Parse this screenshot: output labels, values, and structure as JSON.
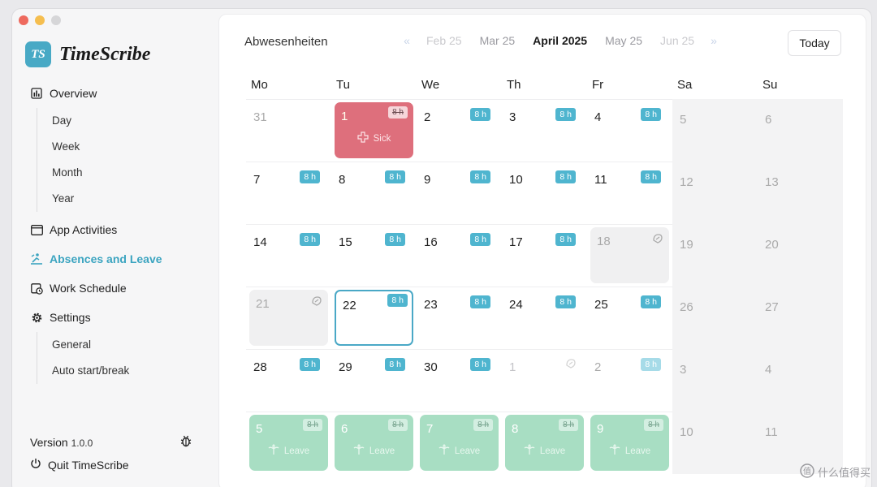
{
  "app": {
    "name": "TimeScribe",
    "logo_text": "TS"
  },
  "sidebar": {
    "overview": "Overview",
    "overview_sub": [
      "Day",
      "Week",
      "Month",
      "Year"
    ],
    "app_activities": "App Activities",
    "absences": "Absences and Leave",
    "work_schedule": "Work Schedule",
    "settings": "Settings",
    "settings_sub": [
      "General",
      "Auto start/break"
    ],
    "version_label": "Version",
    "version_number": "1.0.0",
    "quit": "Quit TimeScribe"
  },
  "main": {
    "title": "Abwesenheiten",
    "months": {
      "far_prev": "Feb 25",
      "prev": "Mar 25",
      "current": "April 2025",
      "next": "May 25",
      "far_next": "Jun 25"
    },
    "today_button": "Today",
    "weekdays": [
      "Mo",
      "Tu",
      "We",
      "Th",
      "Fr",
      "Sa",
      "Su"
    ]
  },
  "calendar": {
    "hours_badge": "8 h",
    "sick_label": "Sick",
    "leave_label": "Leave",
    "weeks": [
      [
        {
          "day": "31",
          "kind": "outside"
        },
        {
          "day": "1",
          "kind": "sick"
        },
        {
          "day": "2",
          "kind": "work"
        },
        {
          "day": "3",
          "kind": "work"
        },
        {
          "day": "4",
          "kind": "work"
        },
        {
          "day": "5",
          "kind": "weekend"
        },
        {
          "day": "6",
          "kind": "weekend"
        }
      ],
      [
        {
          "day": "7",
          "kind": "work"
        },
        {
          "day": "8",
          "kind": "work"
        },
        {
          "day": "9",
          "kind": "work"
        },
        {
          "day": "10",
          "kind": "work"
        },
        {
          "day": "11",
          "kind": "work"
        },
        {
          "day": "12",
          "kind": "weekend"
        },
        {
          "day": "13",
          "kind": "weekend"
        }
      ],
      [
        {
          "day": "14",
          "kind": "work"
        },
        {
          "day": "15",
          "kind": "work"
        },
        {
          "day": "16",
          "kind": "work"
        },
        {
          "day": "17",
          "kind": "work"
        },
        {
          "day": "18",
          "kind": "holiday"
        },
        {
          "day": "19",
          "kind": "weekend"
        },
        {
          "day": "20",
          "kind": "weekend"
        }
      ],
      [
        {
          "day": "21",
          "kind": "holiday"
        },
        {
          "day": "22",
          "kind": "today"
        },
        {
          "day": "23",
          "kind": "work"
        },
        {
          "day": "24",
          "kind": "work"
        },
        {
          "day": "25",
          "kind": "work"
        },
        {
          "day": "26",
          "kind": "weekend"
        },
        {
          "day": "27",
          "kind": "weekend"
        }
      ],
      [
        {
          "day": "28",
          "kind": "work"
        },
        {
          "day": "29",
          "kind": "work"
        },
        {
          "day": "30",
          "kind": "work"
        },
        {
          "day": "1",
          "kind": "outside_holiday"
        },
        {
          "day": "2",
          "kind": "outside_work"
        },
        {
          "day": "3",
          "kind": "weekend_dim"
        },
        {
          "day": "4",
          "kind": "weekend_dim"
        }
      ],
      [
        {
          "day": "5",
          "kind": "leave"
        },
        {
          "day": "6",
          "kind": "leave"
        },
        {
          "day": "7",
          "kind": "leave"
        },
        {
          "day": "8",
          "kind": "leave"
        },
        {
          "day": "9",
          "kind": "leave"
        },
        {
          "day": "10",
          "kind": "weekend_dim"
        },
        {
          "day": "11",
          "kind": "weekend_dim"
        }
      ]
    ]
  },
  "colors": {
    "accent": "#4fb5cf",
    "sick": "#de6f7c",
    "leave": "#a8dec3",
    "holiday": "#f0f0f1"
  },
  "watermark": "什么值得买"
}
